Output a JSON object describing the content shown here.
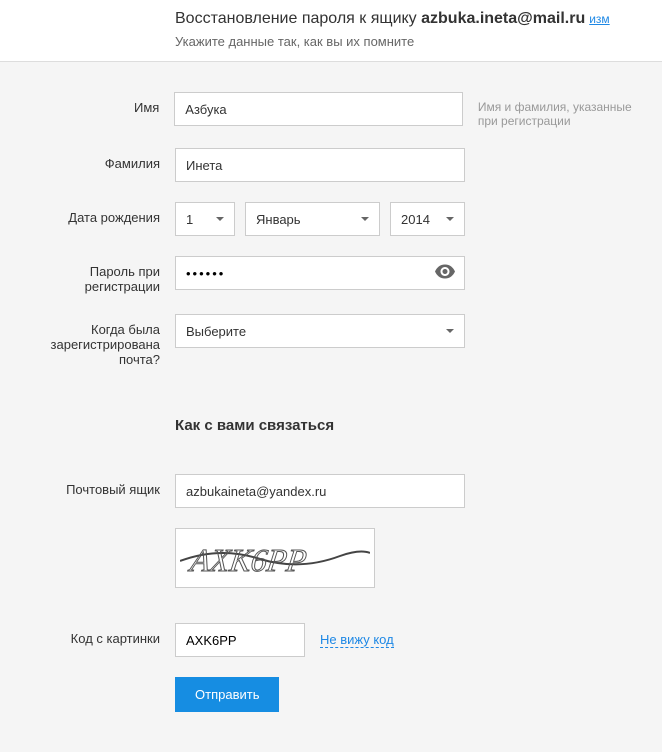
{
  "header": {
    "title_prefix": "Восстановление пароля к ящику ",
    "email": "azbuka.ineta@mail.ru",
    "change_link": "изм",
    "subtitle": "Укажите данные так, как вы их помните"
  },
  "labels": {
    "name": "Имя",
    "surname": "Фамилия",
    "birthdate": "Дата рождения",
    "password": "Пароль при регистрации",
    "registered": "Когда была зарегистрирована почта?",
    "contact_title": "Как с вами связаться",
    "mailbox": "Почтовый ящик",
    "captcha": "Код с картинки"
  },
  "values": {
    "name": "Азбука",
    "surname": "Инета",
    "day": "1",
    "month": "Январь",
    "year": "2014",
    "password": "••••••",
    "registered": "Выберите",
    "email": "azbukaineta@yandex.ru",
    "captcha": "AXK6PP",
    "captcha_image_text": "AXK6PP"
  },
  "hints": {
    "name": "Имя и фамилия, указанные при регистрации"
  },
  "actions": {
    "cant_see": "Не вижу код",
    "submit": "Отправить"
  }
}
